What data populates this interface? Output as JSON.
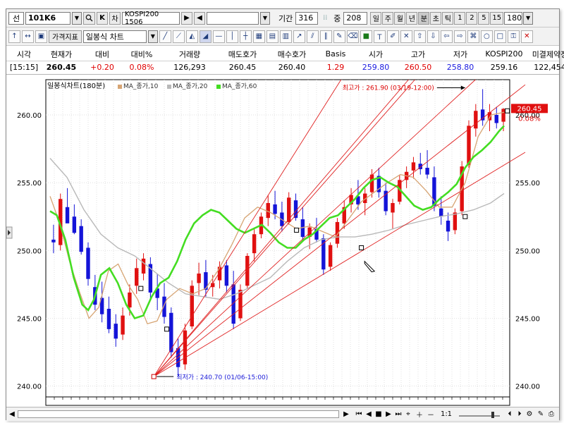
{
  "toolbar": {
    "code_prefix": "선",
    "code_value": "101K6",
    "search_icon": "search-icon",
    "k_label": "K",
    "chart_label": "차",
    "symbol_name": "KOSPI200 1506",
    "period_label": "기간",
    "period_value": "316",
    "count_label": "중",
    "count_value": "208",
    "intervals": [
      "일",
      "주",
      "월",
      "년",
      "분",
      "초",
      "틱"
    ],
    "active_interval": "분",
    "minute_values": [
      "1",
      "2",
      "5",
      "15"
    ],
    "minute_select": "180",
    "indicator_button": "가격지표",
    "chart_type_select": "일봉식 차트"
  },
  "quote": {
    "headers": [
      "시각",
      "현재가",
      "대비",
      "대비%",
      "거래량",
      "매도호가",
      "매수호가",
      "Basis",
      "시가",
      "고가",
      "저가",
      "KOSPI200",
      "미결제약정"
    ],
    "values": [
      "[15:15]",
      "260.45",
      "+0.20",
      "0.08%",
      "126,293",
      "260.45",
      "260.40",
      "1.29",
      "259.80",
      "260.50",
      "258.80",
      "259.16",
      "122,454"
    ],
    "value_colors": [
      "#000000",
      "#000000",
      "#e00000",
      "#e00000",
      "#000000",
      "#000000",
      "#000000",
      "#e00000",
      "#1a1ae0",
      "#e00000",
      "#1a1ae0",
      "#000000",
      "#000000"
    ]
  },
  "legend": {
    "title": "일봉식차트(180분)",
    "items": [
      {
        "name": "MA_종가,10",
        "color": "#d7a574"
      },
      {
        "name": "MA_종가,20",
        "color": "#b9b9b9"
      },
      {
        "name": "MA_종가,60",
        "color": "#44dd22"
      }
    ]
  },
  "chart_data": {
    "type": "candlestick",
    "ylim": [
      239.2,
      262.6
    ],
    "yticks": [
      "260.00",
      "255.00",
      "250.00",
      "245.00",
      "240.00"
    ],
    "current_price_label": "260.45",
    "current_change_label": "0.08%",
    "annotations": {
      "high": "최고가 : 261.90 (03/19-12:00)",
      "low": "최저가 : 240.70 (01/06-15:00)"
    },
    "colors": {
      "up": "#e01010",
      "down": "#1414d8",
      "ma10": "#d7a574",
      "ma20": "#b9b9b9",
      "ma60": "#44dd22",
      "fan": "#e02020"
    },
    "ma60": [
      [
        0,
        252.9
      ],
      [
        8,
        252.6
      ],
      [
        18,
        250.8
      ],
      [
        28,
        248.0
      ],
      [
        38,
        246.0
      ],
      [
        45,
        245.6
      ],
      [
        52,
        246.4
      ],
      [
        60,
        248.2
      ],
      [
        70,
        248.7
      ],
      [
        80,
        247.6
      ],
      [
        90,
        246.0
      ],
      [
        100,
        245.0
      ],
      [
        110,
        245.2
      ],
      [
        120,
        246.6
      ],
      [
        130,
        247.6
      ],
      [
        140,
        248.0
      ],
      [
        150,
        249.2
      ],
      [
        160,
        250.8
      ],
      [
        170,
        252.0
      ],
      [
        180,
        252.6
      ],
      [
        190,
        253.0
      ],
      [
        200,
        252.8
      ],
      [
        210,
        252.2
      ],
      [
        220,
        251.6
      ],
      [
        230,
        251.3
      ],
      [
        240,
        251.6
      ],
      [
        250,
        251.9
      ],
      [
        260,
        251.3
      ],
      [
        270,
        250.6
      ],
      [
        280,
        250.2
      ],
      [
        290,
        250.2
      ],
      [
        300,
        250.8
      ],
      [
        310,
        251.2
      ],
      [
        320,
        251.8
      ],
      [
        330,
        252.4
      ],
      [
        340,
        252.6
      ],
      [
        350,
        253.2
      ],
      [
        360,
        253.8
      ],
      [
        370,
        254.6
      ],
      [
        380,
        255.2
      ],
      [
        390,
        255.4
      ],
      [
        400,
        255.0
      ],
      [
        410,
        254.7
      ],
      [
        420,
        254.0
      ],
      [
        430,
        253.3
      ],
      [
        440,
        253.0
      ],
      [
        450,
        253.2
      ],
      [
        460,
        253.8
      ],
      [
        470,
        254.3
      ],
      [
        480,
        254.9
      ],
      [
        490,
        256.1
      ],
      [
        500,
        256.9
      ],
      [
        510,
        257.4
      ],
      [
        520,
        258.0
      ],
      [
        530,
        258.8
      ],
      [
        536,
        259.2
      ]
    ],
    "ma20": [
      [
        0,
        256.8
      ],
      [
        20,
        255.4
      ],
      [
        40,
        253.0
      ],
      [
        60,
        251.2
      ],
      [
        80,
        250.2
      ],
      [
        100,
        249.6
      ],
      [
        120,
        248.6
      ],
      [
        140,
        247.6
      ],
      [
        160,
        246.8
      ],
      [
        180,
        246.6
      ],
      [
        200,
        246.4
      ],
      [
        220,
        246.8
      ],
      [
        240,
        247.4
      ],
      [
        260,
        248.0
      ],
      [
        280,
        249.2
      ],
      [
        300,
        250.2
      ],
      [
        320,
        250.8
      ],
      [
        340,
        251.0
      ],
      [
        360,
        251.0
      ],
      [
        380,
        251.2
      ],
      [
        400,
        251.5
      ],
      [
        420,
        251.9
      ],
      [
        440,
        252.2
      ],
      [
        460,
        252.5
      ],
      [
        480,
        252.7
      ],
      [
        500,
        253.0
      ],
      [
        520,
        253.5
      ],
      [
        536,
        254.2
      ]
    ],
    "ma10": [
      [
        0,
        254.0
      ],
      [
        15,
        252.0
      ],
      [
        30,
        249.2
      ],
      [
        45,
        247.0
      ],
      [
        60,
        245.0
      ],
      [
        75,
        245.8
      ],
      [
        90,
        248.5
      ],
      [
        105,
        249.0
      ],
      [
        120,
        247.5
      ],
      [
        135,
        246.4
      ],
      [
        150,
        244.6
      ],
      [
        165,
        244.8
      ],
      [
        180,
        246.4
      ],
      [
        200,
        247.2
      ],
      [
        220,
        246.8
      ],
      [
        240,
        247.2
      ],
      [
        260,
        248.6
      ],
      [
        280,
        250.4
      ],
      [
        300,
        252.4
      ],
      [
        320,
        253.2
      ],
      [
        340,
        252.8
      ],
      [
        360,
        252.2
      ],
      [
        380,
        251.6
      ],
      [
        400,
        251.8
      ],
      [
        420,
        251.4
      ],
      [
        440,
        251.0
      ],
      [
        460,
        252.3
      ],
      [
        480,
        253.6
      ],
      [
        500,
        254.3
      ],
      [
        520,
        255.0
      ],
      [
        540,
        255.6
      ],
      [
        560,
        255.4
      ],
      [
        580,
        254.4
      ],
      [
        600,
        253.2
      ],
      [
        620,
        253.2
      ],
      [
        640,
        255.0
      ],
      [
        660,
        258.4
      ],
      [
        680,
        260.0
      ],
      [
        700,
        260.2
      ]
    ],
    "fan_origin": [
      160,
      240.7
    ],
    "fan_targets": [
      [
        334,
        253.9
      ],
      [
        420,
        255.2
      ],
      [
        500,
        259.2
      ],
      [
        640,
        261.9
      ],
      [
        700,
        261.0
      ],
      [
        700,
        256.3
      ]
    ],
    "candles": [
      [
        250.8,
        251.9,
        249.8,
        250.6
      ],
      [
        250.4,
        254.2,
        250.0,
        253.8
      ],
      [
        253.2,
        254.6,
        252.1,
        252.0
      ],
      [
        252.5,
        253.4,
        251.2,
        251.3
      ],
      [
        251.8,
        252.3,
        249.7,
        249.9
      ],
      [
        250.2,
        250.6,
        247.4,
        247.9
      ],
      [
        247.3,
        248.2,
        245.6,
        246.0
      ],
      [
        246.5,
        247.7,
        244.7,
        245.3
      ],
      [
        245.7,
        246.6,
        243.9,
        244.2
      ],
      [
        244.6,
        245.3,
        242.9,
        243.5
      ],
      [
        243.8,
        245.8,
        243.4,
        245.2
      ],
      [
        245.8,
        247.5,
        245.2,
        246.9
      ],
      [
        247.4,
        249.4,
        246.8,
        248.7
      ],
      [
        248.3,
        249.8,
        247.8,
        249.4
      ],
      [
        249.0,
        249.5,
        246.4,
        246.9
      ],
      [
        247.2,
        248.3,
        245.6,
        246.5
      ],
      [
        246.6,
        247.6,
        244.6,
        245.1
      ],
      [
        245.4,
        245.8,
        242.1,
        242.5
      ],
      [
        242.8,
        243.5,
        240.7,
        241.4
      ],
      [
        241.6,
        244.6,
        241.2,
        244.1
      ],
      [
        244.4,
        247.8,
        244.2,
        247.4
      ],
      [
        247.6,
        249.1,
        246.7,
        248.3
      ],
      [
        248.4,
        249.3,
        246.6,
        247.1
      ],
      [
        247.3,
        248.2,
        246.6,
        247.6
      ],
      [
        247.8,
        249.2,
        247.2,
        248.8
      ],
      [
        248.9,
        249.3,
        246.9,
        247.4
      ],
      [
        247.5,
        248.5,
        244.2,
        244.6
      ],
      [
        245.0,
        247.5,
        244.8,
        247.1
      ],
      [
        247.4,
        249.8,
        247.2,
        249.6
      ],
      [
        249.8,
        251.6,
        249.2,
        251.2
      ],
      [
        251.2,
        252.8,
        250.9,
        252.5
      ],
      [
        252.4,
        254.1,
        251.8,
        253.5
      ],
      [
        253.4,
        254.4,
        252.3,
        252.7
      ],
      [
        252.8,
        253.6,
        251.4,
        251.8
      ],
      [
        252.1,
        254.3,
        251.9,
        253.9
      ],
      [
        253.7,
        254.2,
        252.2,
        252.4
      ],
      [
        252.3,
        253.2,
        250.7,
        251.0
      ],
      [
        251.0,
        252.0,
        250.1,
        251.7
      ],
      [
        251.6,
        252.4,
        250.6,
        250.8
      ],
      [
        250.9,
        251.2,
        248.2,
        248.6
      ],
      [
        248.8,
        250.6,
        248.5,
        250.4
      ],
      [
        250.5,
        252.4,
        250.2,
        252.1
      ],
      [
        252.0,
        253.7,
        251.6,
        253.2
      ],
      [
        253.4,
        254.6,
        252.8,
        254.1
      ],
      [
        254.0,
        255.2,
        253.0,
        253.4
      ],
      [
        253.5,
        254.6,
        252.6,
        254.2
      ],
      [
        254.3,
        256.0,
        253.9,
        255.6
      ],
      [
        255.5,
        256.1,
        253.9,
        254.3
      ],
      [
        254.4,
        255.0,
        252.6,
        252.9
      ],
      [
        252.8,
        253.8,
        251.6,
        253.5
      ],
      [
        253.6,
        255.6,
        253.4,
        255.2
      ],
      [
        255.2,
        256.2,
        254.6,
        255.8
      ],
      [
        255.9,
        256.9,
        255.3,
        256.5
      ],
      [
        256.4,
        257.2,
        255.6,
        256.0
      ],
      [
        256.1,
        257.4,
        255.3,
        255.6
      ],
      [
        255.4,
        256.2,
        252.9,
        253.3
      ],
      [
        253.1,
        254.0,
        251.9,
        252.5
      ],
      [
        252.2,
        252.8,
        250.7,
        251.4
      ],
      [
        251.5,
        253.1,
        251.2,
        252.8
      ],
      [
        252.9,
        256.6,
        252.6,
        256.2
      ],
      [
        256.3,
        259.6,
        256.1,
        259.2
      ],
      [
        259.0,
        260.8,
        258.4,
        260.3
      ],
      [
        260.4,
        261.9,
        259.2,
        259.6
      ],
      [
        259.6,
        260.8,
        258.8,
        260.2
      ],
      [
        260.0,
        260.6,
        259.0,
        259.4
      ],
      [
        259.5,
        260.5,
        258.8,
        260.45
      ]
    ]
  },
  "bottom": {
    "scroll_left": "◀",
    "zoom_ratio": "1:1"
  }
}
